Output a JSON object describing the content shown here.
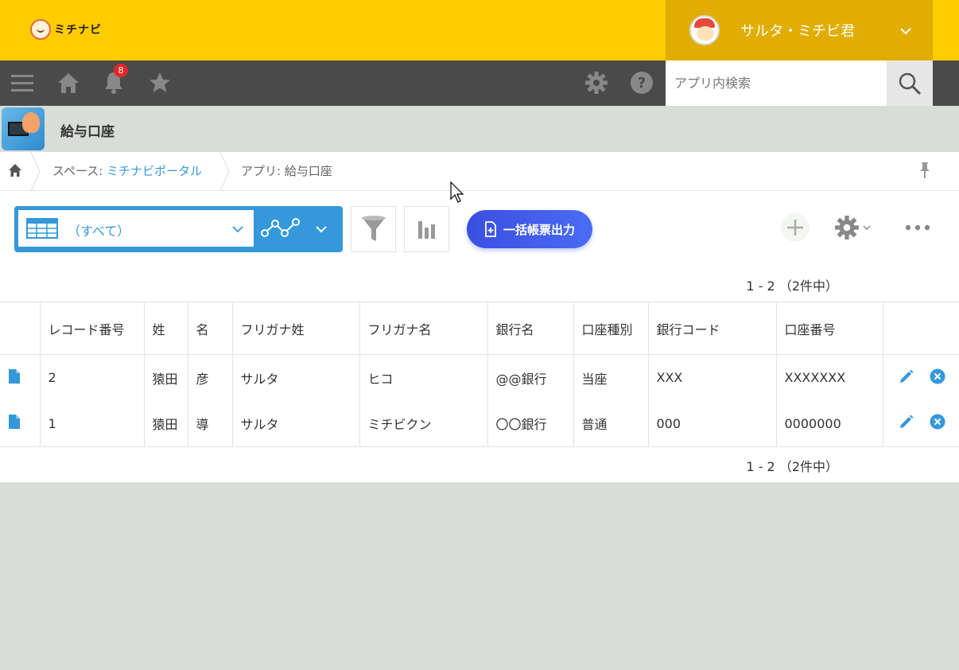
{
  "brand": {
    "logo_text": "ミチナビ"
  },
  "user": {
    "name": "サルタ・ミチビ君"
  },
  "nav": {
    "notification_count": "8",
    "search_placeholder": "アプリ内検索"
  },
  "app": {
    "title": "給与口座"
  },
  "breadcrumb": {
    "space_prefix": "スペース: ",
    "space_link": "ミチナビポータル",
    "app_label": "アプリ: 給与口座"
  },
  "toolbar": {
    "view_label": "（すべて）",
    "export_label": "一括帳票出力"
  },
  "pagination": {
    "top": "1 - 2 （2件中）",
    "bottom": "1 - 2 （2件中）"
  },
  "table": {
    "columns": [
      "レコード番号",
      "姓",
      "名",
      "フリガナ姓",
      "フリガナ名",
      "銀行名",
      "口座種別",
      "銀行コード",
      "口座番号"
    ],
    "rows": [
      [
        "2",
        "猿田",
        "彦",
        "サルタ",
        "ヒコ",
        "@@銀行",
        "当座",
        "XXX",
        "XXXXXXX"
      ],
      [
        "1",
        "猿田",
        "導",
        "サルタ",
        "ミチビクン",
        "〇〇銀行",
        "普通",
        "000",
        "0000000"
      ]
    ]
  },
  "colors": {
    "brand_yellow": "#ffcc00",
    "accent_blue": "#3498db",
    "nav_dark": "#4a4a4a"
  }
}
